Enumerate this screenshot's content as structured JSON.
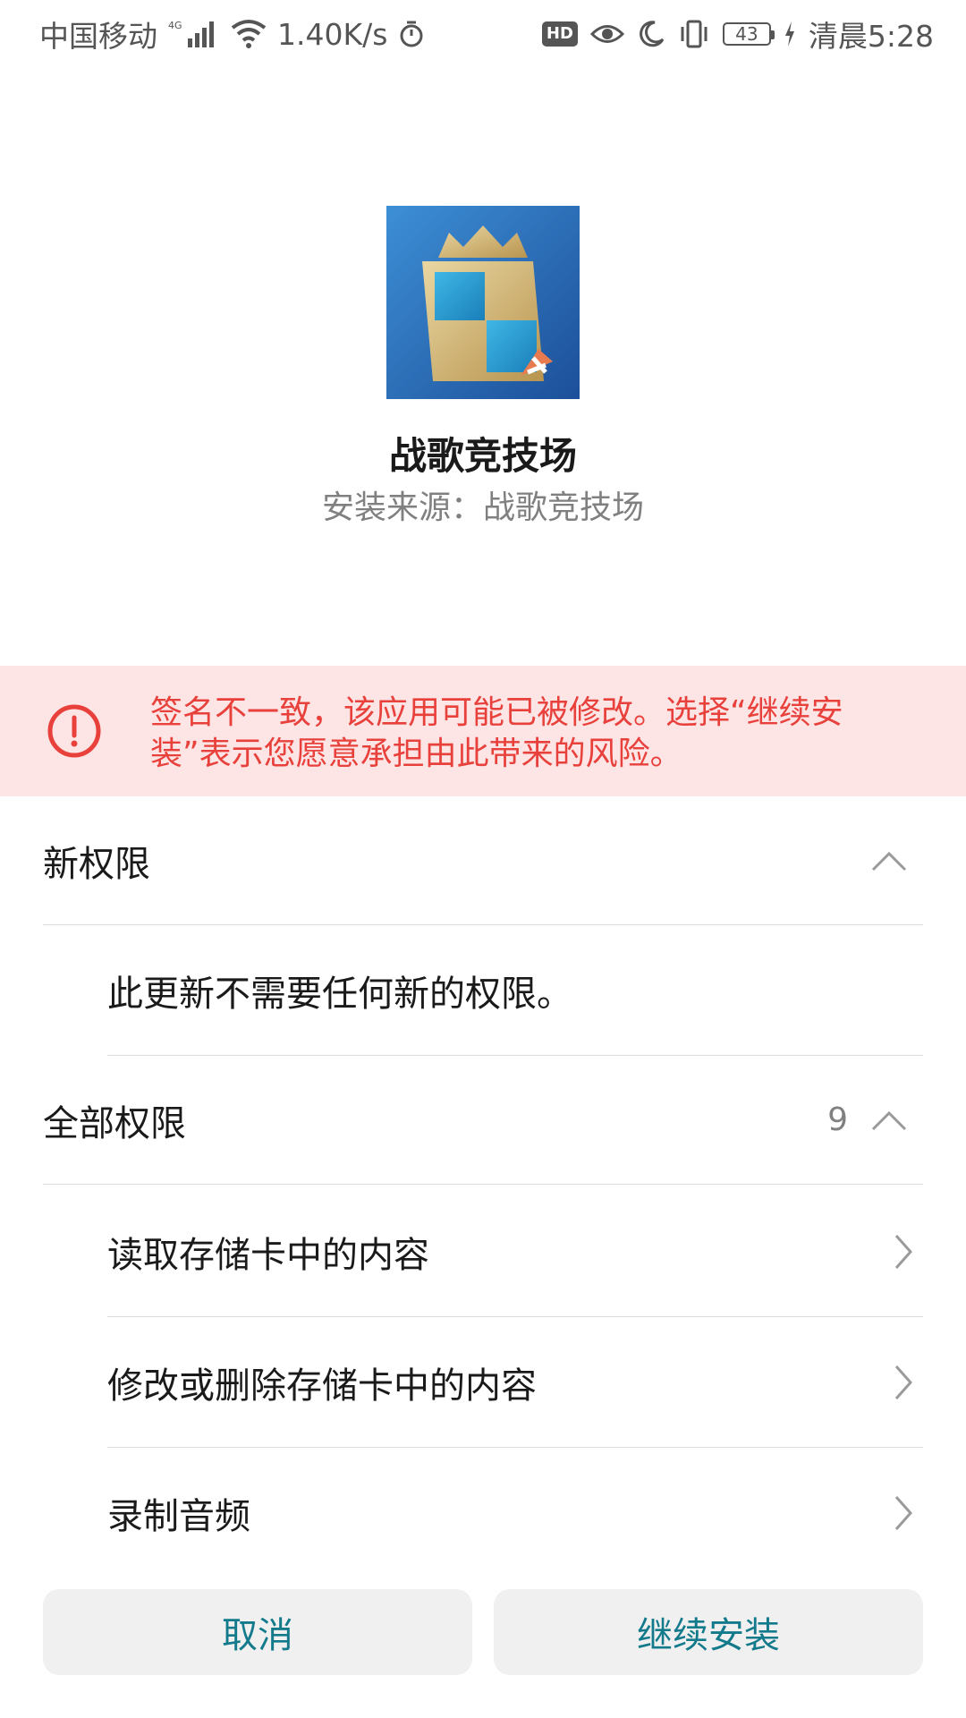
{
  "status_bar": {
    "carrier": "中国移动",
    "network": "4G",
    "speed": "1.40K/s",
    "battery": "43",
    "time": "清晨5:28",
    "hd_label": "HD",
    "icons": [
      "signal-icon",
      "wifi-icon",
      "alarm-icon",
      "hd-icon",
      "eye-icon",
      "moon-icon",
      "vibrate-icon",
      "battery-icon",
      "charging-icon"
    ]
  },
  "app": {
    "name": "战歌竞技场",
    "source": "安装来源：战歌竞技场",
    "icon": "app-icon"
  },
  "warning": {
    "text": "签名不一致，该应用可能已被修改。选择“继续安装”表示您愿意承担由此带来的风险。",
    "color": "#e8413c",
    "background": "#fde4e5",
    "icon": "exclamation-circle-icon"
  },
  "new_permissions": {
    "title": "新权限",
    "items": [
      "此更新不需要任何新的权限。"
    ]
  },
  "all_permissions": {
    "title": "全部权限",
    "count": "9",
    "items": [
      "读取存储卡中的内容",
      "修改或删除存储卡中的内容",
      "录制音频"
    ]
  },
  "buttons": {
    "cancel": "取消",
    "continue": "继续安装",
    "color": "#137a8c"
  }
}
